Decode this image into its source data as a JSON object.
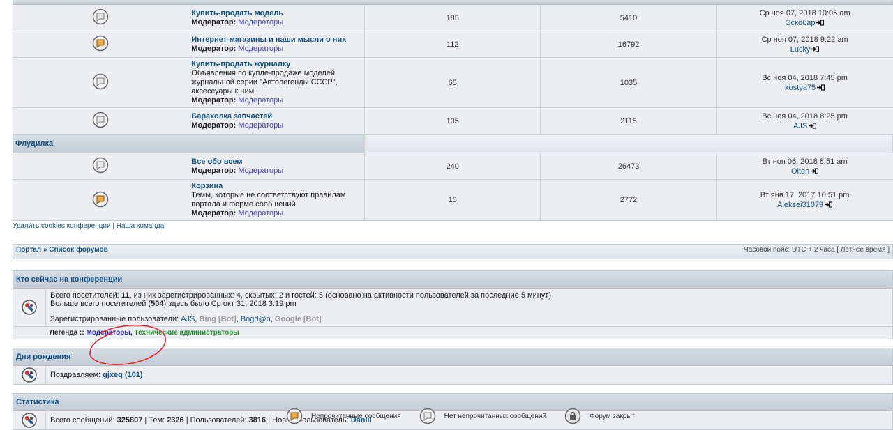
{
  "forums": [
    {
      "title": "Купить-продать модель",
      "desc": "",
      "mod_label": "Модератор:",
      "mod_link": "Модераторы",
      "topics": "185",
      "posts": "5410",
      "last_date": "Ср ноя 07, 2018 10:05 am",
      "last_user": "Эскобар",
      "icon": "read"
    },
    {
      "title": "Интернет-магазины и наши мысли о них",
      "desc": "",
      "mod_label": "Модератор:",
      "mod_link": "Модераторы",
      "topics": "112",
      "posts": "16792",
      "last_date": "Ср ноя 07, 2018 9:22 am",
      "last_user": "Lucky",
      "icon": "unread"
    },
    {
      "title": "Купить-продать журналку",
      "desc": "Объявления по купле-продаже моделей журнальной серии \"Автолегенды СССР\", аксессуары к ним.",
      "mod_label": "Модератор:",
      "mod_link": "Модераторы",
      "topics": "65",
      "posts": "1035",
      "last_date": "Вс ноя 04, 2018 7:45 pm",
      "last_user": "kostya75",
      "icon": "read"
    },
    {
      "title": "Барахолка запчастей",
      "desc": "",
      "mod_label": "Модератор:",
      "mod_link": "Модераторы",
      "topics": "105",
      "posts": "2115",
      "last_date": "Вс ноя 04, 2018 8:25 pm",
      "last_user": "AJS",
      "icon": "read"
    }
  ],
  "category2": "Флудилка",
  "forums2": [
    {
      "title": "Все обо всем",
      "desc": "",
      "mod_label": "Модератор:",
      "mod_link": "Модераторы",
      "topics": "240",
      "posts": "26473",
      "last_date": "Вт ноя 06, 2018 8:51 am",
      "last_user": "Olten",
      "icon": "read"
    },
    {
      "title": "Корзина",
      "desc": "Темы, которые не соответствуют правилам портала и форме сообщений",
      "mod_label": "Модератор:",
      "mod_link": "Модераторы",
      "topics": "15",
      "posts": "2772",
      "last_date": "Вт янв 17, 2017 10:51 pm",
      "last_user": "Aleksei31079",
      "icon": "unread"
    }
  ],
  "links": {
    "delete_cookies": "Удалить cookies конференции",
    "separator": "|",
    "team": "Наша команда"
  },
  "navbar": {
    "portal": "Портал",
    "sep": "»",
    "forums": "Список форумов",
    "timezone": "Часовой пояс: UTC + 2 часа [ Летнее время ]"
  },
  "online": {
    "title": "Кто сейчас на конференции",
    "line1_a": "Всего посетителей: ",
    "line1_total": "11",
    "line1_b": ", из них зарегистрированных: 4, скрытых: 2 и гостей: 5 (основано на активности пользователей за последние 5 минут)",
    "line2_a": "Больше всего посетителей (",
    "line2_max": "504",
    "line2_b": ") здесь было Ср окт 31, 2018 3:19 pm",
    "reg_label": "Зарегистрированные пользователи: ",
    "reg_users": [
      {
        "name": "AJS",
        "kind": "user"
      },
      {
        "name": "Bing [Bot]",
        "kind": "bot"
      },
      {
        "name": "Bogd@n",
        "kind": "user"
      },
      {
        "name": "Google [Bot]",
        "kind": "bot"
      }
    ],
    "legend_label": "Легенда :: ",
    "legend_mods": "Модераторы",
    "legend_comma": ", ",
    "legend_admins": "Технические администраторы"
  },
  "birthdays": {
    "title": "Дни рождения",
    "text": "Поздравляем: ",
    "user": "gjxeq (101)"
  },
  "stats": {
    "title": "Статистика",
    "posts_label": "Всего сообщений: ",
    "posts": "325807",
    "topics_label": " | Тем: ",
    "topics": "2326",
    "users_label": " | Пользователей: ",
    "users": "3816",
    "new_label": " | Новый пользователь: ",
    "new_user": "Daniil"
  },
  "footer_legend": {
    "unread": "Непрочитанные сообщения",
    "read": "Нет непрочитанных сообщений",
    "locked": "Форум закрыт"
  },
  "colors": {
    "link": "#105289",
    "moderator": "#2a29b9",
    "admin": "#1d8d2e",
    "annotation": "#e0262c"
  }
}
